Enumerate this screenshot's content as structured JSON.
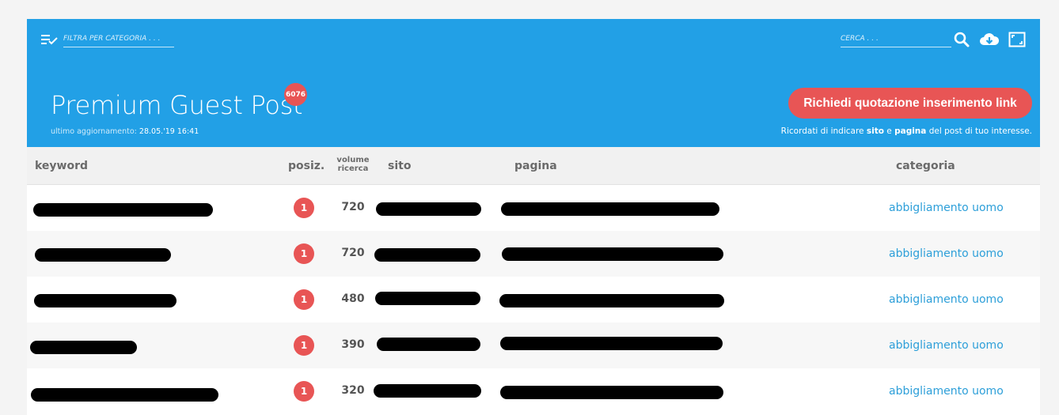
{
  "header": {
    "filter_placeholder": "FILTRA PER CATEGORIA . . .",
    "search_placeholder": "CERCA . . .",
    "title": "Premium Guest Post",
    "count": "6076",
    "updated_label": "ultimo aggiornamento:",
    "updated_value": "28.05.'19 16:41",
    "cta_label": "Richiedi quotazione inserimento link",
    "note_prefix": "Ricordati di indicare ",
    "note_site": "sito",
    "note_mid": " e ",
    "note_page": "pagina",
    "note_suffix": " del post di tuo interesse.",
    "icons": [
      "filter-list-icon",
      "search-icon",
      "cloud-download-icon",
      "fullscreen-icon"
    ],
    "colors": {
      "header_bg": "#22a0e6",
      "accent": "#e85555",
      "link": "#2d9fd9"
    }
  },
  "table": {
    "columns": {
      "keyword": "keyword",
      "posiz": "posiz.",
      "volume_line1": "volume",
      "volume_line2": "ricerca",
      "sito": "sito",
      "pagina": "pagina",
      "categoria": "categoria"
    },
    "rows": [
      {
        "posiz": "1",
        "volume": "720",
        "categoria": "abbigliamento uomo"
      },
      {
        "posiz": "1",
        "volume": "720",
        "categoria": "abbigliamento uomo"
      },
      {
        "posiz": "1",
        "volume": "480",
        "categoria": "abbigliamento uomo"
      },
      {
        "posiz": "1",
        "volume": "390",
        "categoria": "abbigliamento uomo"
      },
      {
        "posiz": "1",
        "volume": "320",
        "categoria": "abbigliamento uomo"
      }
    ]
  }
}
